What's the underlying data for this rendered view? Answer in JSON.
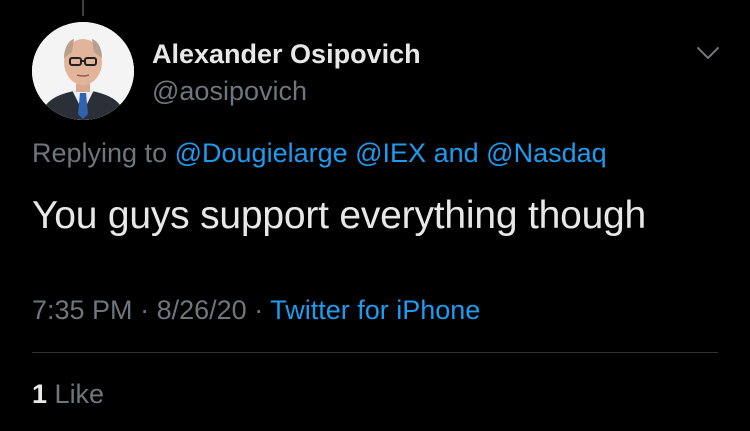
{
  "tweet": {
    "author": {
      "display_name": "Alexander Osipovich",
      "handle": "@aosipovich",
      "avatar_icon": "profile-photo"
    },
    "reply": {
      "prefix": "Replying to",
      "mentions": [
        "@Dougielarge",
        "@IEX",
        "@Nasdaq"
      ],
      "joiner": "and"
    },
    "text": "You guys support everything though",
    "time": "7:35 PM",
    "separator": "·",
    "date": "8/26/20",
    "source": "Twitter for iPhone",
    "likes": {
      "count": "1",
      "label": "Like"
    },
    "menu_icon": "chevron-down-icon"
  },
  "colors": {
    "background": "#000000",
    "primary_text": "#e8e8e8",
    "secondary_text": "#6e767d",
    "accent": "#1d9bf0",
    "divider": "#2f3336"
  }
}
